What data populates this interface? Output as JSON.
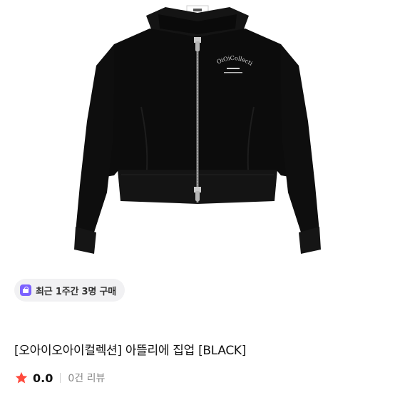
{
  "product": {
    "image_alt": "Black zip-up track jacket with small embroidered logo",
    "jacket_logo_text": "OiOiCollection",
    "purchase_badge": {
      "icon": "shopping-bag-icon",
      "text": "최근 1주간 3명 구매"
    },
    "title": "[오아이오아이컬렉션] 아뜰리에 집업 [BLACK]",
    "rating": {
      "icon": "star-icon",
      "value": "0.0",
      "review_count": "0건 리뷰"
    }
  },
  "colors": {
    "badge_bg": "#f1f1f3",
    "badge_icon": "#7b61ff",
    "star": "#ff4a3d",
    "jacket": "#0c0c0c"
  }
}
